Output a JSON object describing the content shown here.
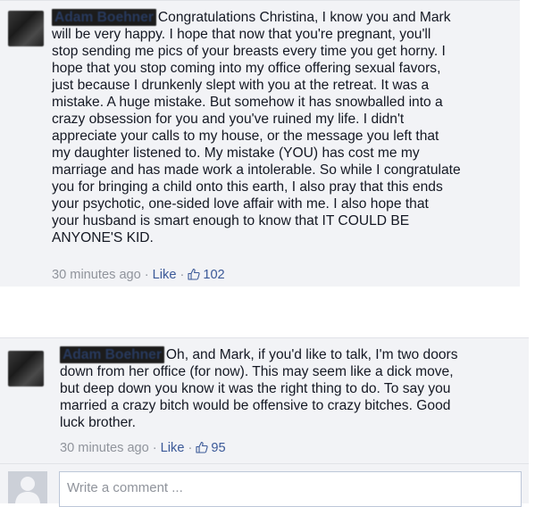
{
  "comments": [
    {
      "author": "Adam Boehner",
      "lines": [
        "Congratulations Christina, I know you and Mark",
        "will be very happy. I hope that now that you're pregnant, you'll",
        "stop sending me pics of your breasts every time you get horny. I",
        "hope that you stop coming into my office offering sexual favors,",
        "just because I drunkenly slept with you at the retreat. It was a",
        "mistake. A huge mistake. But somehow it has snowballed into a",
        "crazy obsession for you and you've ruined my life. I didn't",
        "appreciate your calls to my house, or the message you left that",
        "my daughter listened to. My mistake (YOU) has cost me my",
        "marriage and has made work a intolerable. So while I congratulate",
        "you for bringing a child onto this earth, I also pray that this ends",
        "your psychotic, one-sided love affair with me. I also hope that",
        "your husband is smart enough to know that IT COULD BE",
        "ANYONE'S KID."
      ],
      "timestamp": "30 minutes ago",
      "like_label": "Like",
      "like_count": "102",
      "separator": "·"
    },
    {
      "author": "Adam Boehner",
      "lines": [
        "Oh, and Mark, if you'd like to talk, I'm two doors",
        "down from her office (for now). This may seem like a dick move,",
        "but deep down you know it was the right thing to do. To say you",
        "married a crazy bitch would be offensive to crazy bitches. Good",
        "luck brother."
      ],
      "timestamp": "30 minutes ago",
      "like_label": "Like",
      "like_count": "95",
      "separator": "·"
    }
  ],
  "composer": {
    "placeholder": "Write a comment ..."
  },
  "icons": {
    "like": "thumbs-up-icon",
    "avatar": "user-avatar-icon"
  },
  "colors": {
    "panel_bg": "#f2f3f6",
    "link": "#3b5998",
    "meta": "#90949c"
  }
}
